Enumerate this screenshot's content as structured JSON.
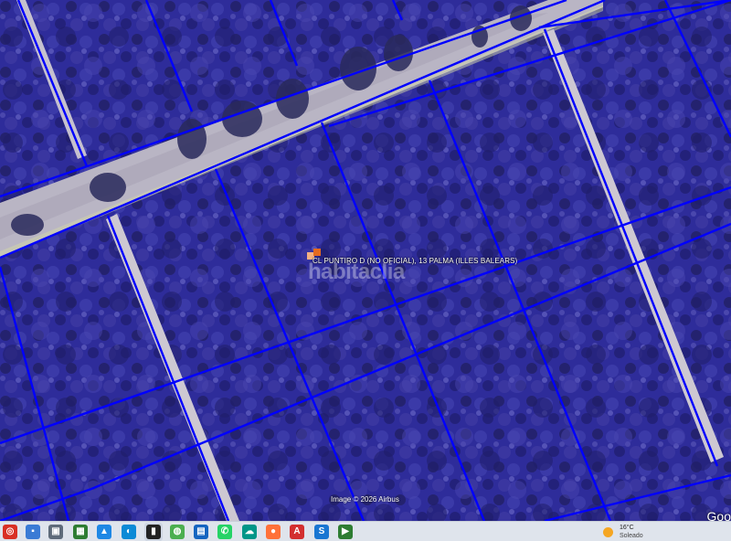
{
  "map": {
    "parcel_color": "#0000ff",
    "overlay_color": "#2a2aa8",
    "address_label": "CL PUNTIRO D (NO OFICIAL), 13  PALMA (ILLES BALEARS)",
    "watermark": "habitaclia",
    "copyright": "Image © 2026 Airbus",
    "google_logo": "Goo"
  },
  "taskbar": {
    "icons": [
      {
        "name": "chrome-icon",
        "color": "#d93025",
        "glyph": "◎"
      },
      {
        "name": "app-icon-1",
        "color": "#3a7bd5",
        "glyph": "▪"
      },
      {
        "name": "printer-icon",
        "color": "#5f6b7a",
        "glyph": "▣"
      },
      {
        "name": "apps-icon",
        "color": "#2e7d32",
        "glyph": "▦"
      },
      {
        "name": "photos-icon",
        "color": "#1e88e5",
        "glyph": "▲"
      },
      {
        "name": "edge-icon",
        "color": "#0c8ad6",
        "glyph": "◐"
      },
      {
        "name": "terminal-icon",
        "color": "#222222",
        "glyph": "▮"
      },
      {
        "name": "maps-app-icon",
        "color": "#4caf50",
        "glyph": "◍"
      },
      {
        "name": "save-icon",
        "color": "#1565c0",
        "glyph": "▤"
      },
      {
        "name": "whatsapp-icon",
        "color": "#25d366",
        "glyph": "✆"
      },
      {
        "name": "teams-icon",
        "color": "#009688",
        "glyph": "☁"
      },
      {
        "name": "firefox-icon",
        "color": "#ff7139",
        "glyph": "●"
      },
      {
        "name": "acrobat-icon",
        "color": "#d32f2f",
        "glyph": "A"
      },
      {
        "name": "sheets-icon",
        "color": "#1976d2",
        "glyph": "S"
      },
      {
        "name": "presentation-icon",
        "color": "#2e7d32",
        "glyph": "▶"
      }
    ],
    "weather": {
      "temperature": "16°C",
      "condition": "Soleado"
    }
  }
}
